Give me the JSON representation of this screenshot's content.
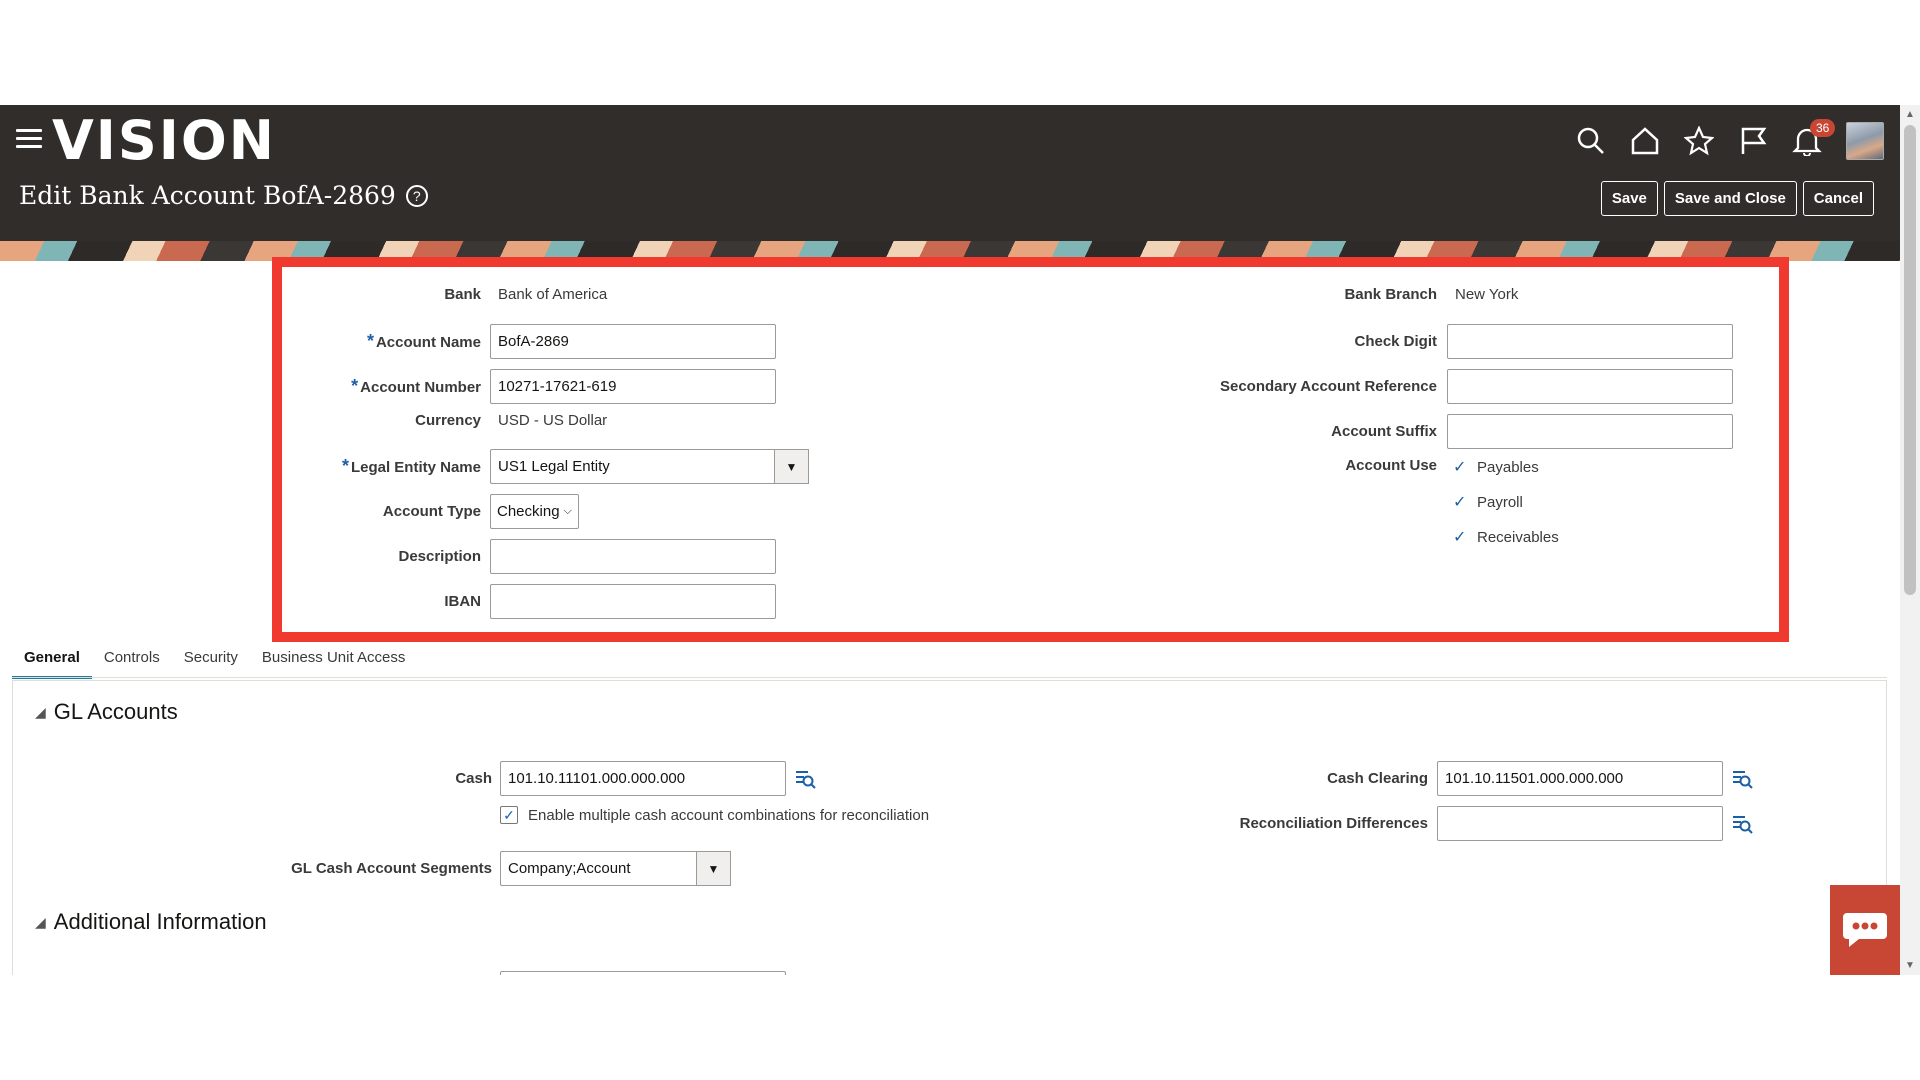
{
  "header": {
    "logo": "VISION",
    "page_title": "Edit Bank Account BofA-2869",
    "help": "?",
    "notification_count": "36",
    "buttons": {
      "save": "Save",
      "save_close": "Save and Close",
      "cancel": "Cancel"
    }
  },
  "account": {
    "bank_label": "Bank",
    "bank_value": "Bank of America",
    "account_name_label": "Account Name",
    "account_name_value": "BofA-2869",
    "account_number_label": "Account Number",
    "account_number_value": "10271-17621-619",
    "currency_label": "Currency",
    "currency_value": "USD - US Dollar",
    "legal_entity_label": "Legal Entity Name",
    "legal_entity_value": "US1 Legal Entity",
    "account_type_label": "Account Type",
    "account_type_value": "Checking",
    "description_label": "Description",
    "description_value": "",
    "iban_label": "IBAN",
    "iban_value": "",
    "bank_branch_label": "Bank Branch",
    "bank_branch_value": "New York",
    "check_digit_label": "Check Digit",
    "check_digit_value": "",
    "secondary_ref_label": "Secondary Account Reference",
    "secondary_ref_value": "",
    "account_suffix_label": "Account Suffix",
    "account_suffix_value": "",
    "account_use_label": "Account Use",
    "account_use": [
      "Payables",
      "Payroll",
      "Receivables"
    ]
  },
  "tabs": [
    "General",
    "Controls",
    "Security",
    "Business Unit Access"
  ],
  "gl_accounts": {
    "title": "GL Accounts",
    "cash_label": "Cash",
    "cash_value": "101.10.11101.000.000.000",
    "enable_multiple_label": "Enable multiple cash account combinations for reconciliation",
    "enable_multiple_checked": true,
    "segments_label": "GL Cash Account Segments",
    "segments_value": "Company;Account",
    "cash_clearing_label": "Cash Clearing",
    "cash_clearing_value": "101.10.11501.000.000.000",
    "recon_diff_label": "Reconciliation Differences",
    "recon_diff_value": ""
  },
  "additional_info": {
    "title": "Additional Information"
  },
  "colors": {
    "header_bg": "#312d2a",
    "highlight": "#f03a2f",
    "accent": "#1b5fa8",
    "chat": "#c74634"
  }
}
